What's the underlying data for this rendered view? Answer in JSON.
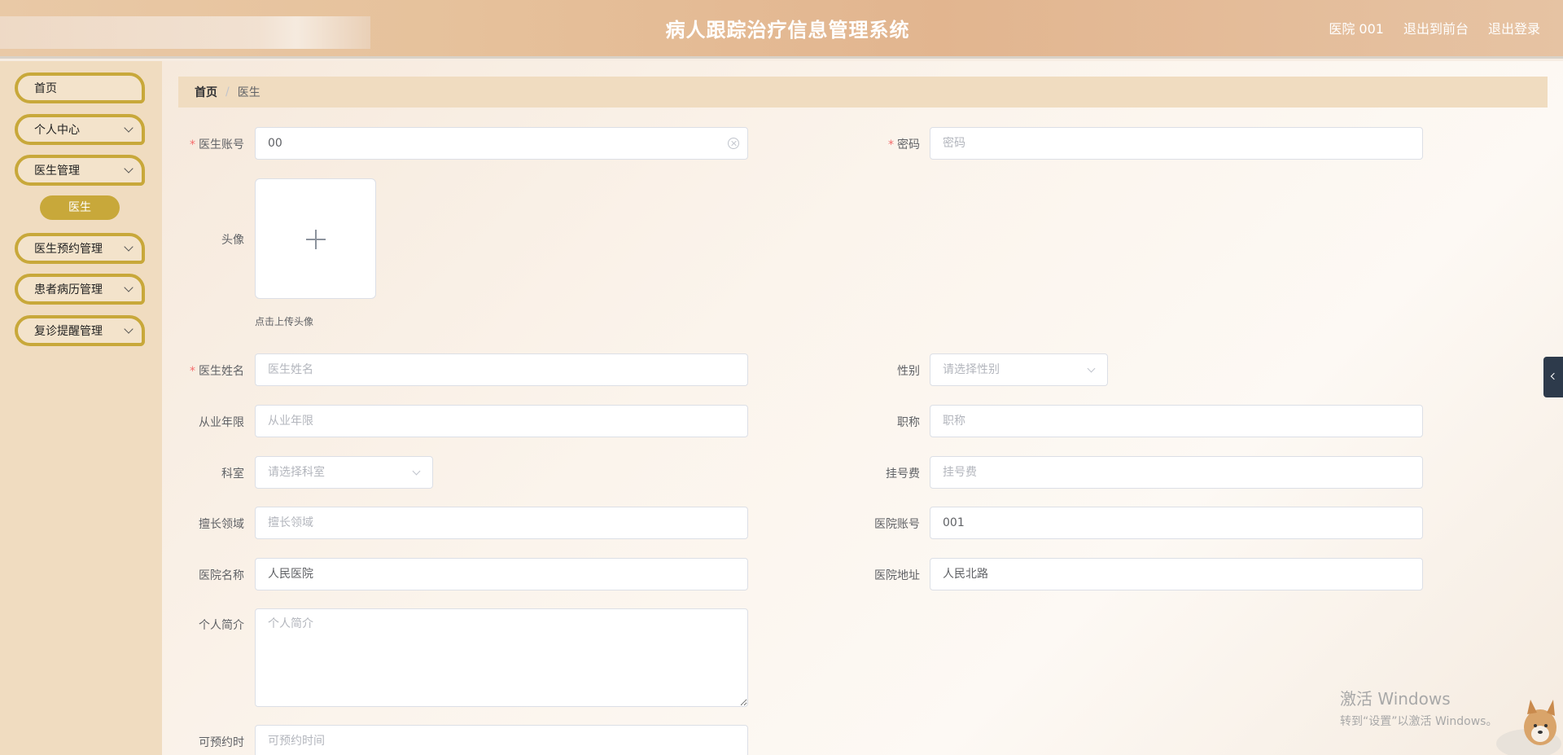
{
  "header": {
    "title": "病人跟踪治疗信息管理系统",
    "user": "医院 001",
    "to_front": "退出到前台",
    "logout": "退出登录"
  },
  "sidebar": {
    "items": [
      {
        "label": "首页",
        "expandable": false
      },
      {
        "label": "个人中心",
        "expandable": true
      },
      {
        "label": "医生管理",
        "expandable": true
      },
      {
        "label": "医生预约管理",
        "expandable": true
      },
      {
        "label": "患者病历管理",
        "expandable": true
      },
      {
        "label": "复诊提醒管理",
        "expandable": true
      }
    ],
    "active_sub": "医生"
  },
  "breadcrumb": {
    "home": "首页",
    "separator": "/",
    "current": "医生"
  },
  "form": {
    "doctor_account": {
      "label": "医生账号",
      "value": "00",
      "required": true
    },
    "password": {
      "label": "密码",
      "placeholder": "密码",
      "required": true
    },
    "avatar": {
      "label": "头像",
      "tip": "点击上传头像"
    },
    "doctor_name": {
      "label": "医生姓名",
      "placeholder": "医生姓名",
      "required": true
    },
    "gender": {
      "label": "性别",
      "placeholder": "请选择性别"
    },
    "years": {
      "label": "从业年限",
      "placeholder": "从业年限"
    },
    "title": {
      "label": "职称",
      "placeholder": "职称"
    },
    "department": {
      "label": "科室",
      "placeholder": "请选择科室"
    },
    "fee": {
      "label": "挂号费",
      "placeholder": "挂号费"
    },
    "specialty": {
      "label": "擅长领域",
      "placeholder": "擅长领域"
    },
    "hospital_account": {
      "label": "医院账号",
      "value": "001"
    },
    "hospital_name": {
      "label": "医院名称",
      "value": "人民医院"
    },
    "hospital_address": {
      "label": "医院地址",
      "value": "人民北路"
    },
    "intro": {
      "label": "个人简介",
      "placeholder": "个人简介"
    },
    "available_time": {
      "label": "可预约时",
      "placeholder": "可预约时间"
    }
  },
  "watermark": {
    "line1": "激活 Windows",
    "line2": "转到“设置”以激活 Windows。"
  },
  "colors": {
    "accent": "#c8a83a",
    "sidebar_bg": "#f0dcc0",
    "required": "#f56c6c"
  }
}
